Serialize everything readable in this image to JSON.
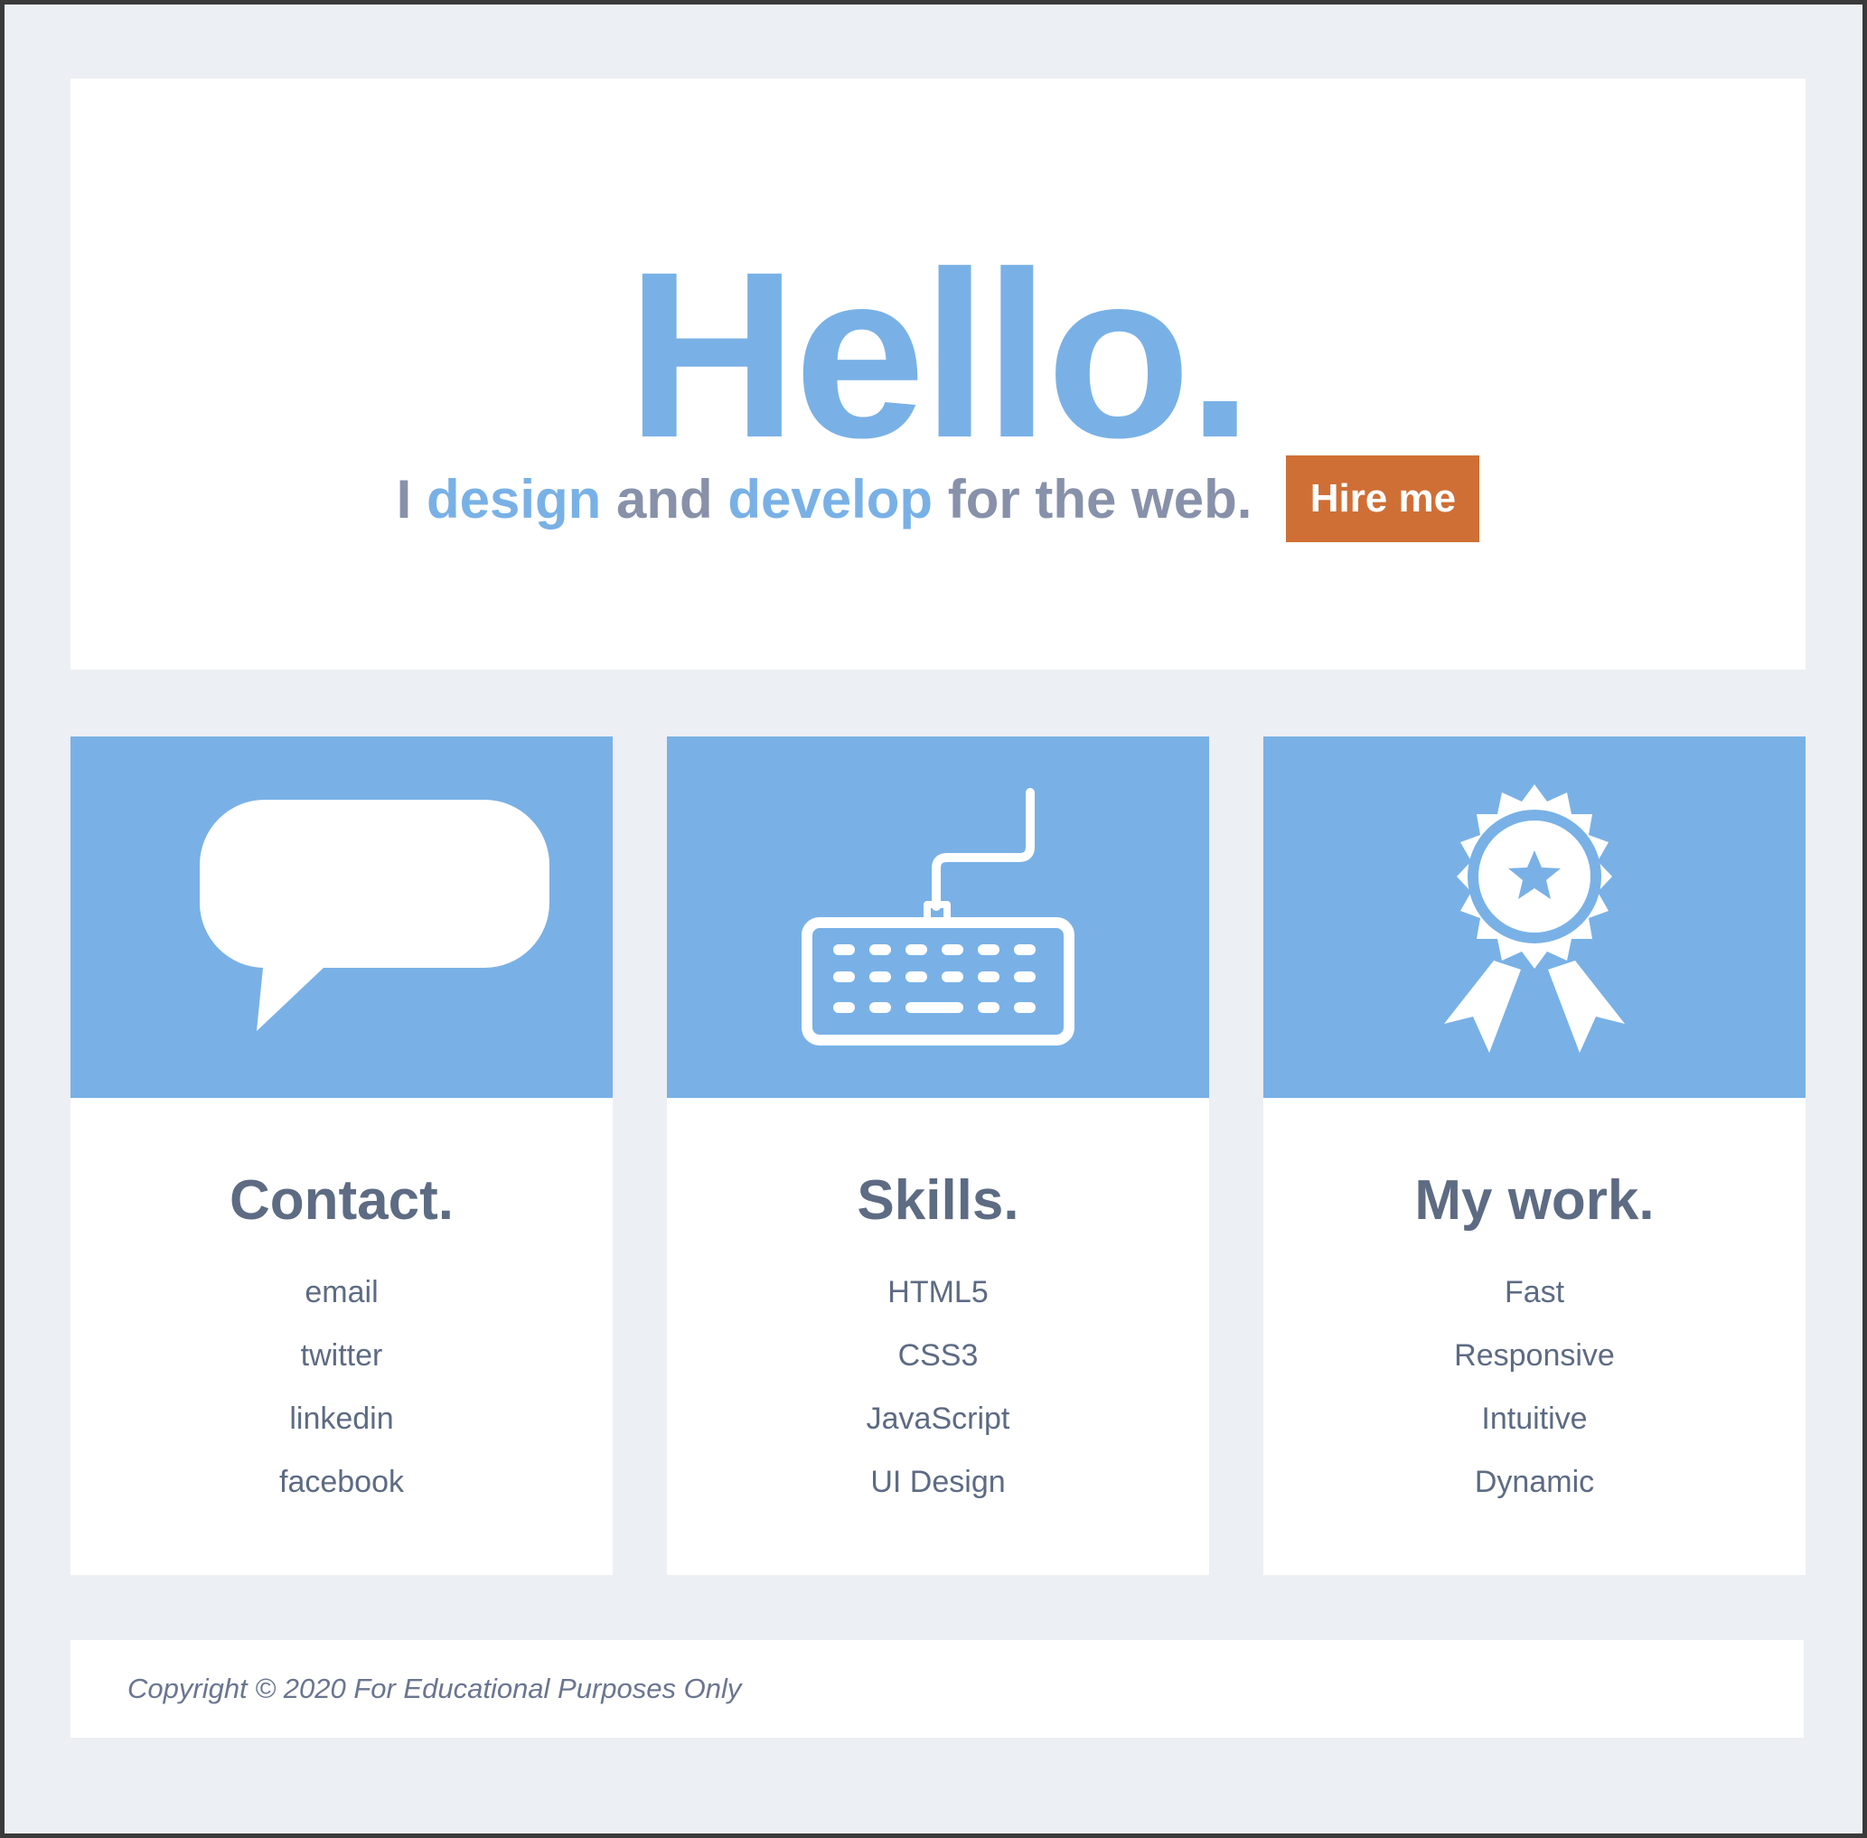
{
  "colors": {
    "accent": "#79b1e6",
    "button": "#cf6f36",
    "text": "#5d6b83",
    "page_background": "#eceff3"
  },
  "hero": {
    "title": "Hello.",
    "tagline": {
      "part1": "I ",
      "accent1": "design",
      "part2": " and ",
      "accent2": "develop",
      "part3": " for the web."
    },
    "hire_button": "Hire me"
  },
  "cards": [
    {
      "icon": "speech-bubble-icon",
      "title": "Contact.",
      "items": [
        "email",
        "twitter",
        "linkedin",
        "facebook"
      ]
    },
    {
      "icon": "keyboard-icon",
      "title": "Skills.",
      "items": [
        "HTML5",
        "CSS3",
        "JavaScript",
        "UI Design"
      ]
    },
    {
      "icon": "award-ribbon-icon",
      "title": "My work.",
      "items": [
        "Fast",
        "Responsive",
        "Intuitive",
        "Dynamic"
      ]
    }
  ],
  "footer": {
    "copyright": "Copyright © 2020 For Educational Purposes Only"
  }
}
